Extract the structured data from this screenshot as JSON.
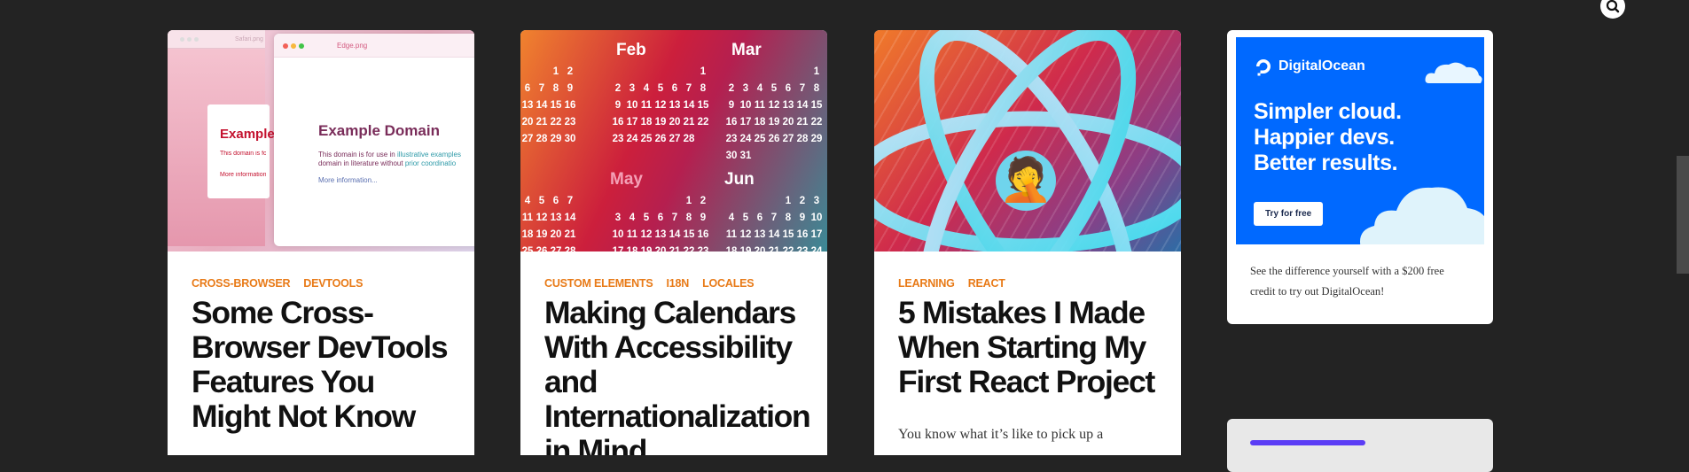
{
  "cards": [
    {
      "tags": [
        "CROSS-BROWSER",
        "DEVTOOLS"
      ],
      "title": "Some Cross-Browser DevTools Features You Might Not Know",
      "thumb": {
        "tab1": "Safari.png",
        "tab2": "Edge.png",
        "heading1": "Example",
        "heading2": "Example Domain",
        "body1": "This domain is for use in",
        "body1b": "illustrative examples",
        "body2": "domain in literature without",
        "body2b": "prior coordinatio",
        "link": "More information..."
      }
    },
    {
      "tags": [
        "CUSTOM ELEMENTS",
        "I18N",
        "LOCALES"
      ],
      "title": "Making Calendars With Accessibility and Internationalization in Mind",
      "thumb": {
        "months": [
          "Feb",
          "Mar",
          "May",
          "Jun"
        ]
      }
    },
    {
      "tags": [
        "LEARNING",
        "REACT"
      ],
      "title": "5 Mistakes I Made When Starting My First React Project",
      "excerpt": "You know what it’s like to pick up a",
      "thumb": {
        "emoji": "🤦"
      }
    }
  ],
  "ad": {
    "brand": "DigitalOcean",
    "headline": [
      "Simpler cloud.",
      "Happier devs.",
      "Better results."
    ],
    "button": "Try for free",
    "text": "See the difference yourself with a $200 free credit to try out DigitalOcean!"
  },
  "colors": {
    "background": "#232323",
    "tag": "#e87a17",
    "do_blue": "#0069ff"
  }
}
